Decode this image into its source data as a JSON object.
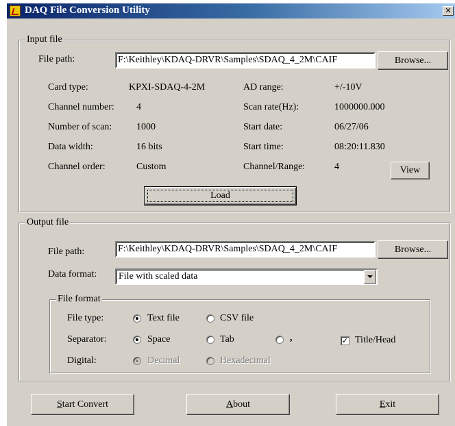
{
  "window": {
    "title": "DAQ File Conversion Utility",
    "close_label": "✕"
  },
  "input": {
    "legend": "Input file",
    "file_path_label": "File path:",
    "file_path_value": "F:\\Keithley\\KDAQ-DRVR\\Samples\\SDAQ_4_2M\\CAIF",
    "browse_label": "Browse...",
    "card_type_label": "Card type:",
    "card_type_value": "KPXI-SDAQ-4-2M",
    "channel_number_label": "Channel number:",
    "channel_number_value": "4",
    "num_scan_label": "Number of scan:",
    "num_scan_value": "1000",
    "data_width_label": "Data width:",
    "data_width_value": "16 bits",
    "channel_order_label": "Channel order:",
    "channel_order_value": "Custom",
    "ad_range_label": "AD range:",
    "ad_range_value": "+/-10V",
    "scan_rate_label": "Scan rate(Hz):",
    "scan_rate_value": "1000000.000",
    "start_date_label": "Start date:",
    "start_date_value": "06/27/06",
    "start_time_label": "Start time:",
    "start_time_value": "08:20:11.830",
    "channel_range_label": "Channel/Range:",
    "channel_range_value": "4",
    "view_label": "View",
    "load_label": "Load"
  },
  "output": {
    "legend": "Output file",
    "file_path_label": "File path:",
    "file_path_value": "F:\\Keithley\\KDAQ-DRVR\\Samples\\SDAQ_4_2M\\CAIF",
    "browse_label": "Browse...",
    "data_format_label": "Data format:",
    "data_format_value": "File with scaled data",
    "file_format": {
      "legend": "File format",
      "file_type_label": "File type:",
      "text_file_label": "Text file",
      "csv_file_label": "CSV file",
      "separator_label": "Separator:",
      "space_label": "Space",
      "tab_label": "Tab",
      "comma_label": ",",
      "title_head_label": "Title/Head",
      "digital_label": "Digital:",
      "decimal_label": "Decimal",
      "hex_label": "Hexadecimal"
    }
  },
  "buttons": {
    "start_convert_key": "S",
    "start_convert_rest": "tart Convert",
    "about_key": "A",
    "about_rest": "bout",
    "exit_key": "E",
    "exit_rest": "xit"
  }
}
